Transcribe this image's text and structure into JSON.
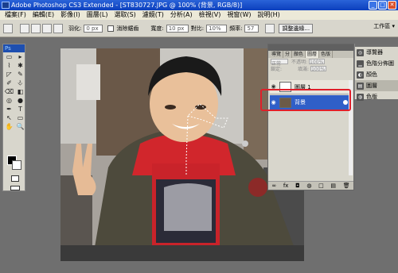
{
  "window": {
    "title": "Adobe Photoshop CS3 Extended - [ST830727.JPG @ 100% (背景, RGB/8)]"
  },
  "menu": [
    "檔案(F)",
    "編輯(E)",
    "影像(I)",
    "圖層(L)",
    "選取(S)",
    "濾鏡(T)",
    "分析(A)",
    "檢視(V)",
    "視窗(W)",
    "說明(H)"
  ],
  "options": {
    "feather_label": "羽化:",
    "feather_value": "0 px",
    "antialias_label": "消除鋸齒",
    "width_label": "寬度:",
    "width_value": "10 px",
    "contrast_label": "對比:",
    "contrast_value": "10%",
    "frequency_label": "頻率:",
    "frequency_value": "57",
    "refine_button": "調整邊緣...",
    "workspace_label": "工作區 ▾"
  },
  "toolbox": {
    "header": "Ps"
  },
  "tools": [
    "▭",
    "▸",
    "⌇",
    "✱",
    "◸",
    "✎",
    "✐",
    "⎀",
    "⌫",
    "◧",
    "◎",
    "●",
    "✒",
    "T",
    "↖",
    "▭",
    "✋",
    "🔍"
  ],
  "layers_panel": {
    "tabs": [
      "導覽",
      "分",
      "顏色",
      "圖層",
      "色版"
    ],
    "blend_mode": "正常",
    "opacity_label": "不透明:",
    "opacity_value": "100%",
    "lock_label": "鎖定:",
    "fill_label": "填滿:",
    "fill_value": "100%",
    "layers": [
      {
        "name": "圖層 1",
        "visible": true
      },
      {
        "name": "背景",
        "visible": true,
        "selected": true
      }
    ],
    "footer_icons": [
      "∞",
      "fx",
      "◘",
      "◍",
      "□",
      "▤",
      "🗑"
    ]
  },
  "dock": {
    "items": [
      "導覽器",
      "色階分佈圖",
      "顏色",
      "圖層",
      "色版"
    ],
    "active": "圖層"
  },
  "colors": {
    "highlight": "#e0202a",
    "selected_layer": "#2f5fc8"
  }
}
